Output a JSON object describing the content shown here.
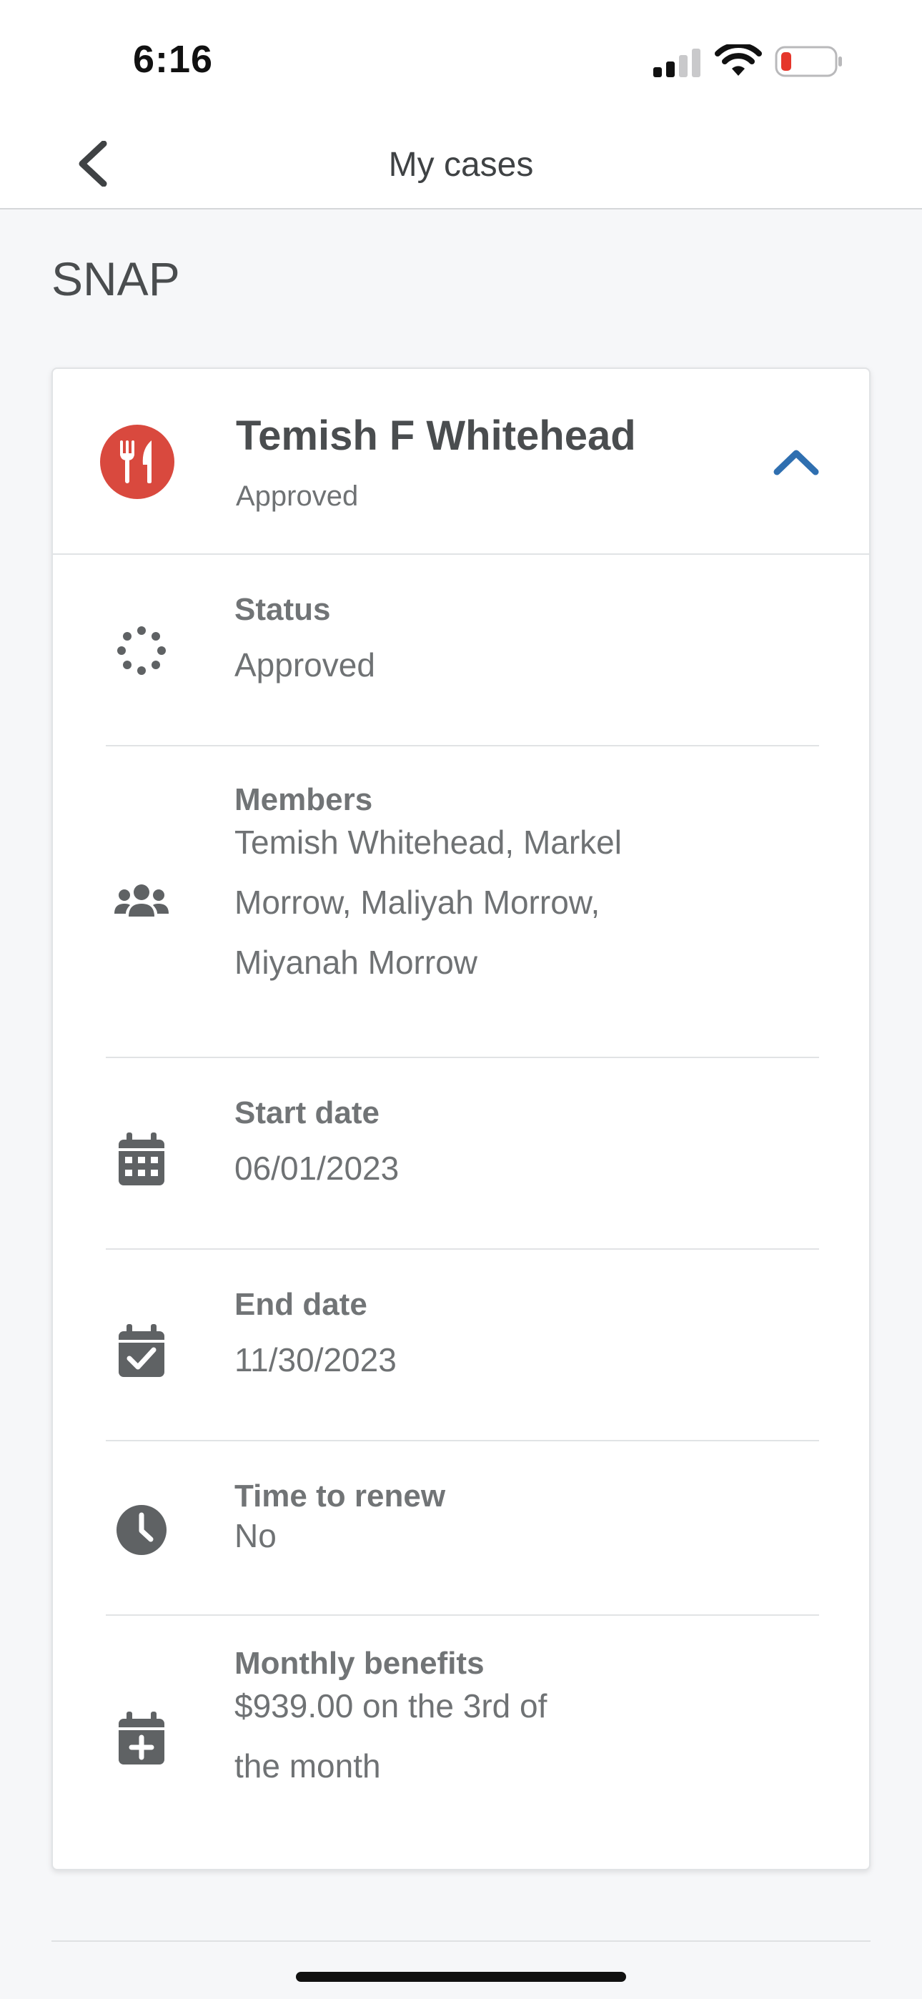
{
  "status_bar": {
    "time": "6:16"
  },
  "nav": {
    "title": "My cases"
  },
  "section": {
    "title": "SNAP"
  },
  "case": {
    "name": "Temish F Whitehead",
    "status": "Approved",
    "program_icon": "fork-knife-icon",
    "accent_color": "#d9493e",
    "chevron_color": "#2f6fb0"
  },
  "details": [
    {
      "icon": "spinner-icon",
      "label": "Status",
      "value": "Approved"
    },
    {
      "icon": "users-icon",
      "label": "Members",
      "value_lines": [
        "Temish Whitehead, Markel",
        "Morrow, Maliyah Morrow,",
        "Miyanah Morrow"
      ]
    },
    {
      "icon": "calendar-icon",
      "label": "Start date",
      "value": "06/01/2023"
    },
    {
      "icon": "calendar-check-icon",
      "label": "End date",
      "value": "11/30/2023"
    },
    {
      "icon": "clock-icon",
      "label": "Time to renew",
      "value": "No"
    },
    {
      "icon": "calendar-plus-icon",
      "label": "Monthly benefits",
      "value_lines": [
        "$939.00 on the 3rd of",
        "the month"
      ]
    }
  ]
}
